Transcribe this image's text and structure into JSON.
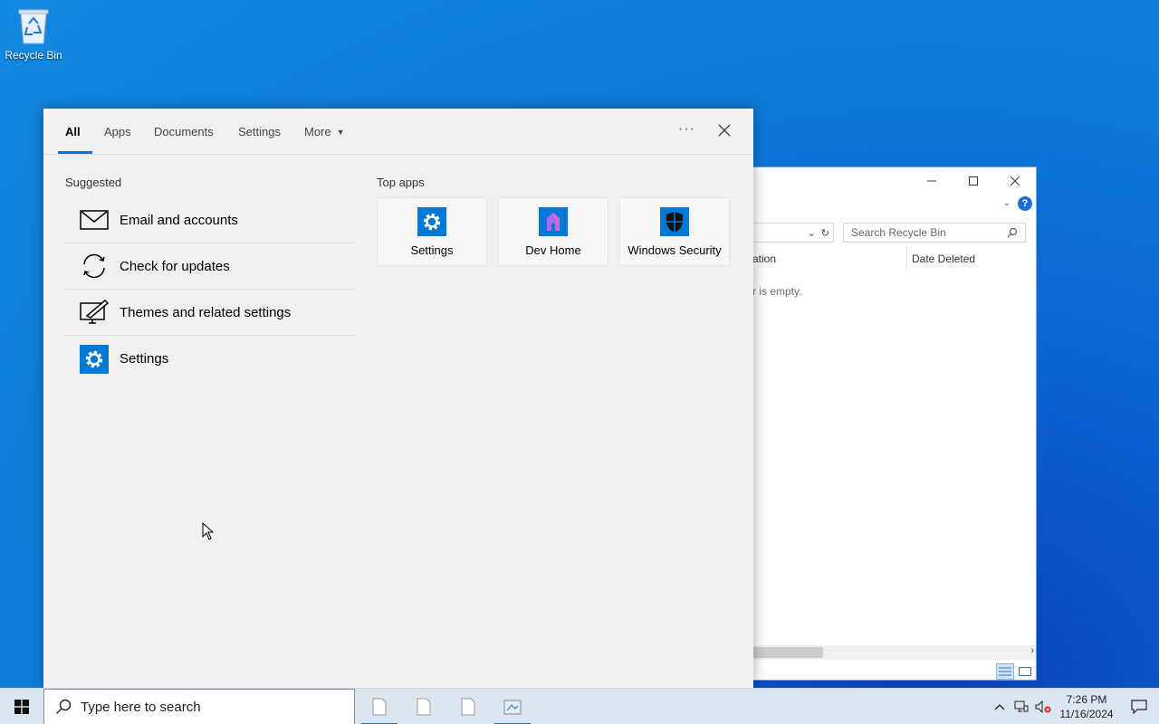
{
  "desktop": {
    "recycle_bin_label": "Recycle Bin"
  },
  "explorer": {
    "search_placeholder": "Search Recycle Bin",
    "column_location_partial": "ation",
    "column_date_deleted": "Date Deleted",
    "empty_message_partial": "r is empty.",
    "help_label": "?"
  },
  "search_panel": {
    "tabs": [
      {
        "label": "All"
      },
      {
        "label": "Apps"
      },
      {
        "label": "Documents"
      },
      {
        "label": "Settings"
      },
      {
        "label": "More"
      }
    ],
    "active_tab": "All",
    "ellipsis": "···",
    "suggested_title": "Suggested",
    "suggested": [
      {
        "label": "Email and accounts",
        "icon": "mail-icon"
      },
      {
        "label": "Check for updates",
        "icon": "sync-icon"
      },
      {
        "label": "Themes and related settings",
        "icon": "themes-icon"
      },
      {
        "label": "Settings",
        "icon": "settings-gear-icon"
      }
    ],
    "top_apps_title": "Top apps",
    "top_apps": [
      {
        "label": "Settings",
        "icon": "settings-gear-icon"
      },
      {
        "label": "Dev Home",
        "icon": "dev-home-icon"
      },
      {
        "label": "Windows Security",
        "icon": "shield-icon"
      }
    ]
  },
  "taskbar": {
    "search_placeholder": "Type here to search",
    "time": "7:26 PM",
    "date": "11/16/2024"
  },
  "colors": {
    "accent": "#0078d7",
    "settings_tile": "#0078d4",
    "dev_home_purple": "#8b5cf6"
  }
}
